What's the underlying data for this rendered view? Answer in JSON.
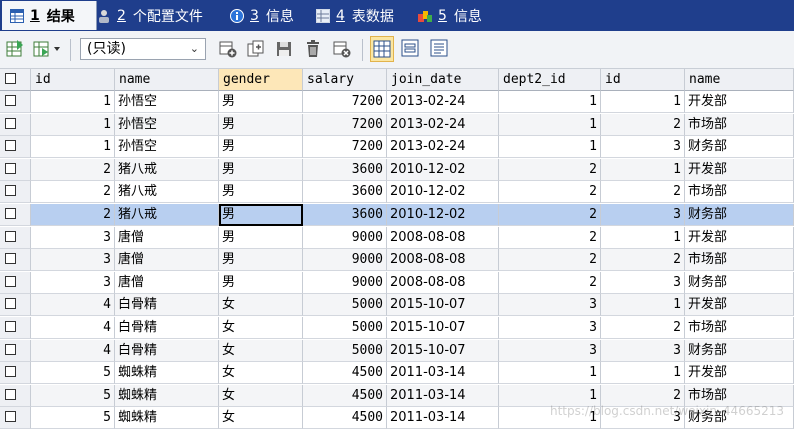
{
  "tabs": [
    {
      "num": "1",
      "label": "结果",
      "active": true
    },
    {
      "num": "2",
      "label": "个配置文件",
      "active": false
    },
    {
      "num": "3",
      "label": "信息",
      "active": false
    },
    {
      "num": "4",
      "label": "表数据",
      "active": false
    },
    {
      "num": "5",
      "label": "信息",
      "active": false
    }
  ],
  "toolbar": {
    "readonly_label": "(只读)"
  },
  "grid": {
    "columns": [
      "id",
      "name",
      "gender",
      "salary",
      "join_date",
      "dept2_id",
      "id",
      "name"
    ],
    "sorted_column": "gender",
    "selected_row": 5,
    "focused_col": 2,
    "rows": [
      [
        "1",
        "孙悟空",
        "男",
        "7200",
        "2013-02-24",
        "1",
        "1",
        "开发部"
      ],
      [
        "1",
        "孙悟空",
        "男",
        "7200",
        "2013-02-24",
        "1",
        "2",
        "市场部"
      ],
      [
        "1",
        "孙悟空",
        "男",
        "7200",
        "2013-02-24",
        "1",
        "3",
        "财务部"
      ],
      [
        "2",
        "猪八戒",
        "男",
        "3600",
        "2010-12-02",
        "2",
        "1",
        "开发部"
      ],
      [
        "2",
        "猪八戒",
        "男",
        "3600",
        "2010-12-02",
        "2",
        "2",
        "市场部"
      ],
      [
        "2",
        "猪八戒",
        "男",
        "3600",
        "2010-12-02",
        "2",
        "3",
        "财务部"
      ],
      [
        "3",
        "唐僧",
        "男",
        "9000",
        "2008-08-08",
        "2",
        "1",
        "开发部"
      ],
      [
        "3",
        "唐僧",
        "男",
        "9000",
        "2008-08-08",
        "2",
        "2",
        "市场部"
      ],
      [
        "3",
        "唐僧",
        "男",
        "9000",
        "2008-08-08",
        "2",
        "3",
        "财务部"
      ],
      [
        "4",
        "白骨精",
        "女",
        "5000",
        "2015-10-07",
        "3",
        "1",
        "开发部"
      ],
      [
        "4",
        "白骨精",
        "女",
        "5000",
        "2015-10-07",
        "3",
        "2",
        "市场部"
      ],
      [
        "4",
        "白骨精",
        "女",
        "5000",
        "2015-10-07",
        "3",
        "3",
        "财务部"
      ],
      [
        "5",
        "蜘蛛精",
        "女",
        "4500",
        "2011-03-14",
        "1",
        "1",
        "开发部"
      ],
      [
        "5",
        "蜘蛛精",
        "女",
        "4500",
        "2011-03-14",
        "1",
        "2",
        "市场部"
      ],
      [
        "5",
        "蜘蛛精",
        "女",
        "4500",
        "2011-03-14",
        "1",
        "3",
        "财务部"
      ]
    ]
  },
  "watermark": "https://blog.csdn.net/weixin_44665213",
  "colors": {
    "tabbar": "#1f3e8c",
    "selected_row": "#b8cff0",
    "sorted_header": "#fde7b8"
  }
}
